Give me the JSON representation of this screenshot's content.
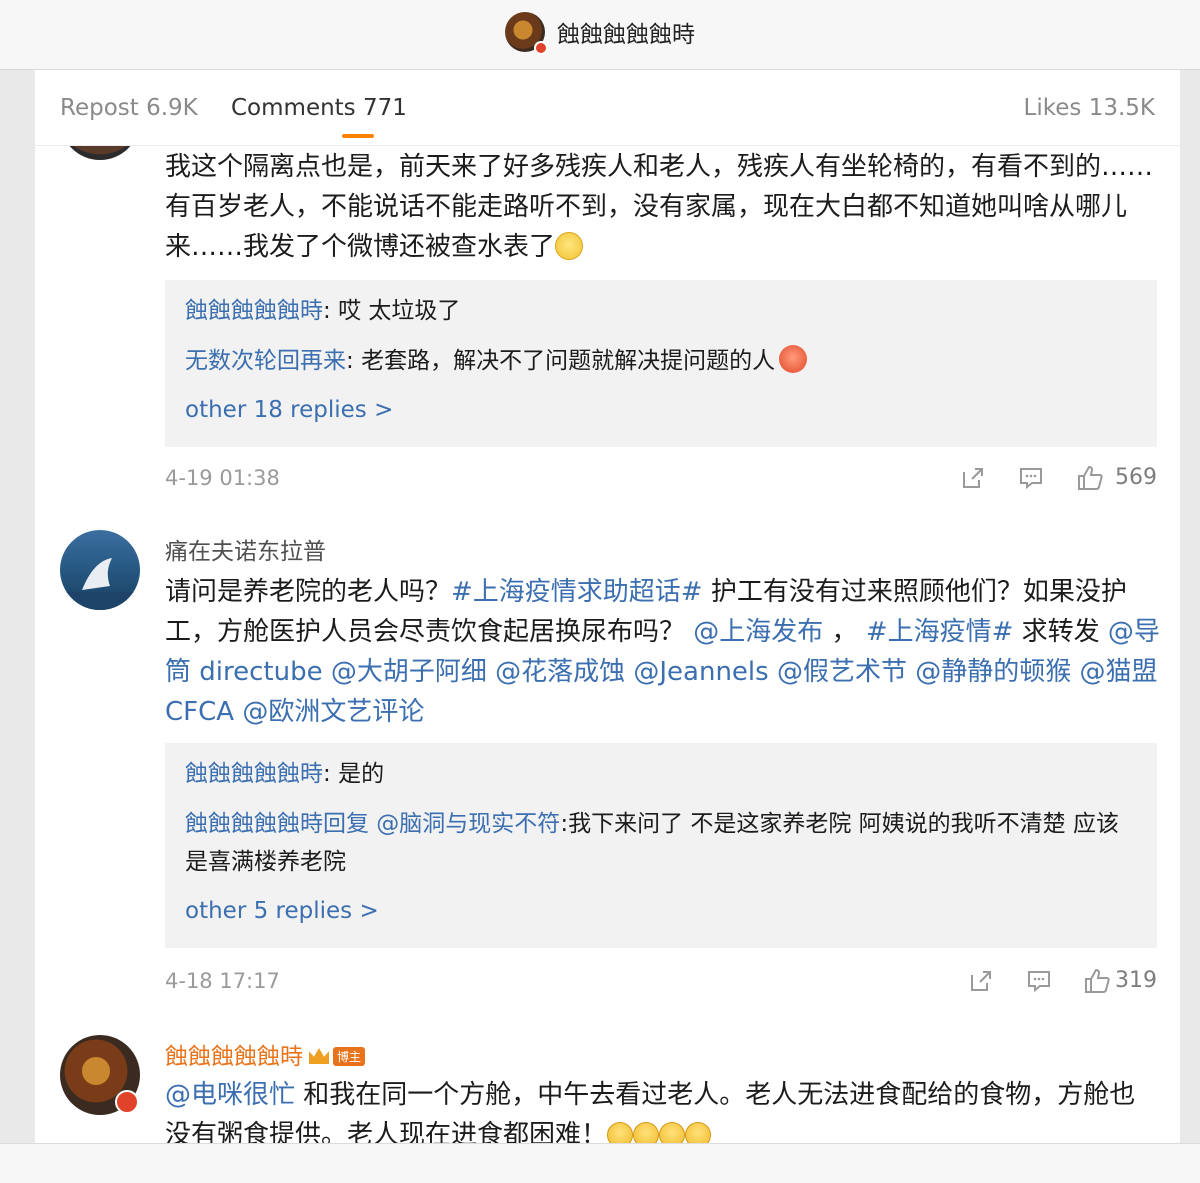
{
  "header": {
    "title": "蝕蝕蝕蝕蝕時"
  },
  "tabs": {
    "repost": "Repost 6.9K",
    "comments": "Comments 771",
    "likes": "Likes 13.5K"
  },
  "comments": [
    {
      "text": "我这个隔离点也是，前天来了好多残疾人和老人，残疾人有坐轮椅的，有看不到的……有百岁老人，不能说话不能走路听不到，没有家属，现在大白都不知道她叫啥从哪儿来……我发了个微博还被查水表了",
      "replies": [
        {
          "name": "蝕蝕蝕蝕蝕時",
          "sep": ": ",
          "text": "哎 太垃圾了"
        },
        {
          "name": "无数次轮回再来",
          "sep": ": ",
          "text": "老套路，解决不了问题就解决提问题的人"
        }
      ],
      "more": "other 18 replies >",
      "time": "4-19 01:38",
      "likes": "569"
    },
    {
      "username": "痛在夫诺东拉普",
      "text_parts": {
        "p1": "请问是养老院的老人吗？",
        "l1": "#上海疫情求助超话#",
        "p2": " 护工有没有过来照顾他们？如果没护工，方舱医护人员会尽责饮食起居换尿布吗？ ",
        "l2": "@上海发布",
        "p3": " ， ",
        "l3": "#上海疫情#",
        "p4": " 求转发 ",
        "l4": "@导筒 directube @大胡子阿细 @花落成蚀 @Jeannels @假艺术节 @静静的顿猴 @猫盟 CFCA @欧洲文艺评论"
      },
      "replies": [
        {
          "name": "蝕蝕蝕蝕蝕時",
          "sep": ": ",
          "text": "是的"
        },
        {
          "name": "蝕蝕蝕蝕蝕時回复 @脑洞与现实不符",
          "sep": ":",
          "text": "我下来问了 不是这家养老院 阿姨说的我听不清楚 应该是喜满楼养老院"
        }
      ],
      "more": "other 5 replies >",
      "time": "4-18 17:17",
      "likes": "319"
    },
    {
      "username": "蝕蝕蝕蝕蝕時",
      "tag": "博主",
      "mention": "@电咪很忙",
      "text": " 和我在同一个方舱，中午去看过老人。老人无法进食配给的食物，方舱也没有粥食提供。老人现在进食都困难！"
    }
  ],
  "colors": {
    "accent": "#ff8200",
    "link": "#3b6fb0",
    "author": "#e8731a"
  }
}
